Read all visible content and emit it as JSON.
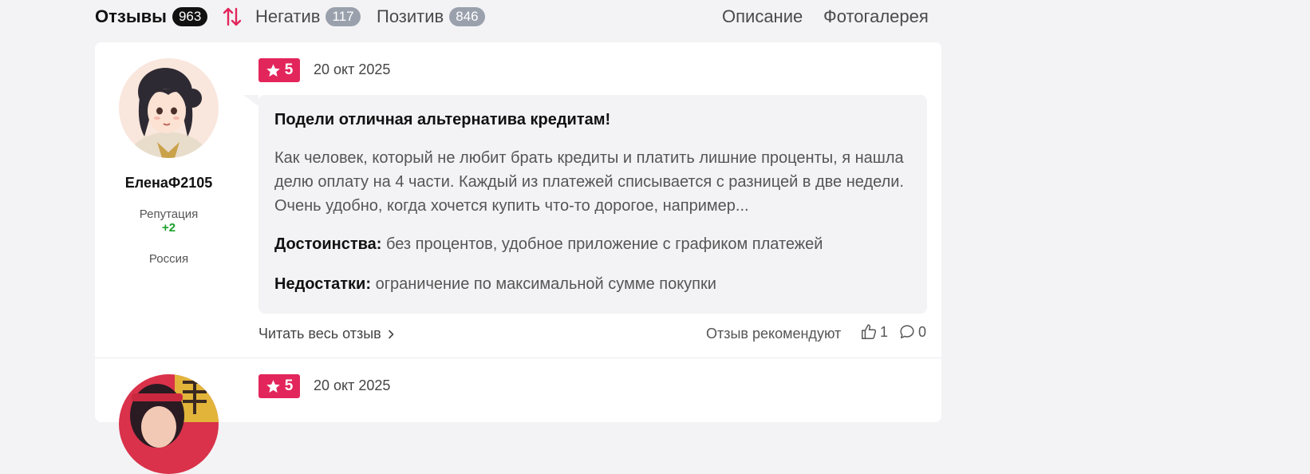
{
  "nav": {
    "tabs": [
      {
        "label": "Отзывы",
        "count": "963"
      },
      {
        "label": "Негатив",
        "count": "117"
      },
      {
        "label": "Позитив",
        "count": "846"
      }
    ],
    "links": [
      "Описание",
      "Фотогалерея"
    ]
  },
  "reviews": [
    {
      "author": "ЕленаФ2105",
      "reputation_label": "Репутация",
      "reputation_value": "+2",
      "country": "Россия",
      "rating": "5",
      "date": "20 окт 2025",
      "title": "Подели отличная альтернатива кредитам!",
      "text": "Как человек, который не любит брать кредиты и платить лишние проценты, я нашла делю оплату на 4 части. Каждый из платежей списывается с разницей в две недели. Очень удобно, когда хочется купить что-то дорогое, например...",
      "pros_label": "Достоинства:",
      "pros": "без процентов, удобное приложение с графиком платежей",
      "cons_label": "Недостатки:",
      "cons": "ограничение по максимальной сумме покупки",
      "read_more": "Читать весь отзыв",
      "recommend_label": "Отзыв рекомендуют",
      "likes": "1",
      "comments": "0"
    },
    {
      "rating": "5",
      "date": "20 окт 2025"
    }
  ],
  "colors": {
    "accent": "#e2265b",
    "reputation": "#19a12a",
    "badge": "#9aa1ad",
    "background": "#f3f3f5"
  }
}
